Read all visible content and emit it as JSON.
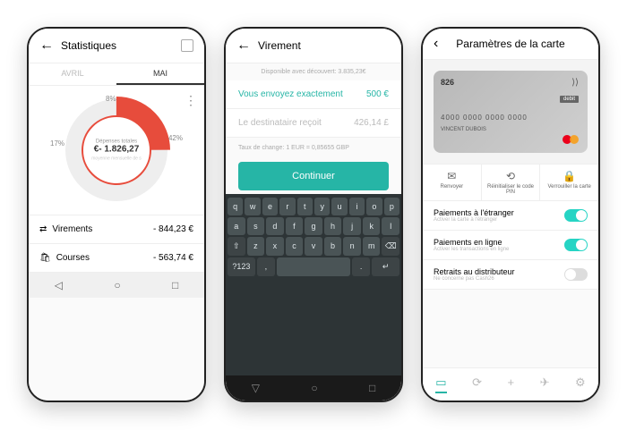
{
  "phone1": {
    "title": "Statistiques",
    "tabs": [
      "AVRIL",
      "MAI"
    ],
    "activeTab": 1,
    "donut": {
      "label": "Dépenses totales",
      "value": "€- 1.826,27",
      "sub": "moyenne mensuelle de s",
      "segments": [
        {
          "pct": "8%",
          "icon": "bag"
        },
        {
          "pct": "42%",
          "icon": "card"
        },
        {
          "pct": "17%",
          "icon": "car"
        }
      ]
    },
    "rows": [
      {
        "icon": "⇄",
        "label": "Virements",
        "amount": "- 844,23 €"
      },
      {
        "icon": "🛍",
        "label": "Courses",
        "amount": "- 563,74 €"
      }
    ]
  },
  "phone2": {
    "title": "Virement",
    "available": "Disponible avec découvert: 3.835,23€",
    "sendLabel": "Vous envoyez exactement",
    "sendAmount": "500 €",
    "recvLabel": "Le destinataire reçoit",
    "recvAmount": "426,14 £",
    "rate": "Taux de change: 1 EUR = 0,85655 GBP",
    "continue": "Continuer",
    "keys": {
      "r1": [
        "q",
        "w",
        "e",
        "r",
        "t",
        "y",
        "u",
        "i",
        "o",
        "p"
      ],
      "r2": [
        "a",
        "s",
        "d",
        "f",
        "g",
        "h",
        "j",
        "k",
        "l"
      ],
      "r3": [
        "⇧",
        "z",
        "x",
        "c",
        "v",
        "b",
        "n",
        "m",
        "⌫"
      ],
      "r4": [
        "?123",
        ",",
        "",
        "",
        ".",
        "↵"
      ]
    }
  },
  "phone3": {
    "title": "Paramètres de la carte",
    "card": {
      "brand": "826",
      "number": "4000 0000 0000 0000",
      "holder": "VINCENT DUBOIS",
      "debit": "debit",
      "network": "mastercard"
    },
    "actions": [
      {
        "icon": "✉",
        "label": "Renvoyer"
      },
      {
        "icon": "⟲",
        "label": "Réinitialiser le code PIN"
      },
      {
        "icon": "🔒",
        "label": "Verrouiller la carte"
      }
    ],
    "settings": [
      {
        "title": "Paiements à l'étranger",
        "sub": "Activer la carte à l'étranger",
        "on": true
      },
      {
        "title": "Paiements en ligne",
        "sub": "Activer les transactions en ligne",
        "on": true
      },
      {
        "title": "Retraits au distributeur",
        "sub": "Ne concerne pas Cash26",
        "on": false
      }
    ]
  }
}
